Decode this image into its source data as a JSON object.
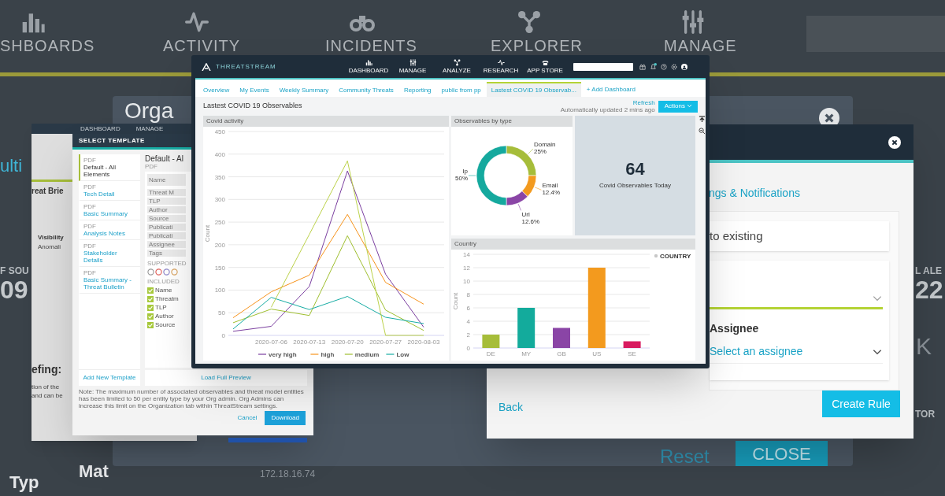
{
  "background_app": {
    "nav": [
      "SHBOARDS",
      "ACTIVITY",
      "INCIDENTS",
      "EXPLORER",
      "MANAGE"
    ],
    "panel_title": "Orga",
    "texts": [
      {
        "text": "ulti",
        "kind": "link"
      },
      {
        "text": "F SOU",
        "kind": "label"
      },
      {
        "text": "09",
        "kind": "big"
      },
      {
        "text": "Mat",
        "kind": "heading"
      },
      {
        "text": "Typ",
        "kind": "heading"
      },
      {
        "text": "172.18.16.74",
        "kind": "faint"
      },
      {
        "text": "L ALE",
        "kind": "label"
      },
      {
        "text": "22",
        "kind": "big"
      },
      {
        "text": "K",
        "kind": "faint-big"
      },
      {
        "text": "TOR",
        "kind": "label"
      }
    ],
    "footer_buttons": [
      {
        "label": "Reset",
        "kind": "link"
      },
      {
        "label": "CLOSE",
        "kind": "primary"
      }
    ]
  },
  "report_window": {
    "nav": [
      "DASHBOARD",
      "MANAGE"
    ],
    "texts": [
      "reat Brie",
      "Visibility",
      "Anomali",
      "efing:",
      "tion of the",
      "and can be"
    ]
  },
  "template_dialog": {
    "title": "SELECT TEMPLATE",
    "templates": [
      {
        "type": "PDF",
        "name": "Default - All Elements",
        "selected": true
      },
      {
        "type": "PDF",
        "name": "Tech Detail",
        "selected": false
      },
      {
        "type": "PDF",
        "name": "Basic Summary",
        "selected": false
      },
      {
        "type": "PDF",
        "name": "Analysis Notes",
        "selected": false
      },
      {
        "type": "PDF",
        "name": "Stakeholder Details",
        "selected": false
      },
      {
        "type": "PDF",
        "name": "Basic Summary - Threat Bulletin",
        "selected": false
      }
    ],
    "add_template": "Add New Template",
    "preview_title": "Default - Al",
    "preview_type": "PDF",
    "fields": [
      "Name",
      "Threat M",
      "TLP",
      "Author",
      "Source",
      "Publicati",
      "Publicati",
      "Assignee",
      "Tags"
    ],
    "media_label": "SUPPORTED",
    "elements_label": "INCLUDED",
    "elements": [
      {
        "label": "Name",
        "checked": true
      },
      {
        "label": "Threatm",
        "checked": true
      },
      {
        "label": "TLP",
        "checked": true
      },
      {
        "label": "Author",
        "checked": true
      },
      {
        "label": "Source",
        "checked": true
      }
    ],
    "load_preview": "Load Full Preview",
    "note": "Note: The maximum number of associated observables and threat model entities has been limited to 50 per entity type by your Org admin. Org Admins can increase this limit on the Organization tab within ThreatStream settings.",
    "buttons": [
      {
        "label": "Cancel",
        "kind": "link"
      },
      {
        "label": "Download",
        "kind": "primary"
      }
    ]
  },
  "rule_dialog": {
    "section_title": "ngs & Notifications",
    "option": "to existing",
    "assignee_label": "Assignee",
    "assignee_placeholder": "Select an assignee",
    "back": "Back",
    "create": "Create Rule"
  },
  "main_window": {
    "brand": "THREATSTREAM",
    "nav": [
      "DASHBOARD",
      "MANAGE",
      "ANALYZE",
      "RESEARCH",
      "APP STORE"
    ],
    "tabs": [
      {
        "label": "Overview",
        "selected": false
      },
      {
        "label": "My Events",
        "selected": false
      },
      {
        "label": "Weekly Summary",
        "selected": false
      },
      {
        "label": "Community Threats",
        "selected": false
      },
      {
        "label": "Reporting",
        "selected": false
      },
      {
        "label": "public from pp",
        "selected": false
      },
      {
        "label": "Lastest COVID 19 Observab...",
        "selected": true
      }
    ],
    "add_tab": "+ Add Dashboard",
    "title": "Lastest COVID 19 Observables",
    "refresh": "Refresh",
    "updated": "Automatically updated 2 mins ago",
    "actions": "Actions",
    "activity": {
      "title": "Covid activity",
      "chart_data": {
        "type": "line",
        "ylabel": "Count",
        "categories": [
          null,
          "2020-07-06",
          "2020-07-13",
          "2020-07-20",
          "2020-07-27",
          "2020-08-03"
        ],
        "ylim": [
          0,
          450
        ],
        "yticks": [
          0,
          50,
          100,
          150,
          200,
          250,
          300,
          350,
          400,
          450
        ],
        "grid": true,
        "legend": true,
        "series": [
          {
            "name": "very high",
            "color": "#7b3fa0",
            "values": [
              9,
              20,
              108,
              363,
              135,
              18
            ]
          },
          {
            "name": "high",
            "color": "#f7941d",
            "values": [
              39,
              96,
              133,
              267,
              117,
              69
            ]
          },
          {
            "name": "medium",
            "color": "#9fbf2f",
            "values": [
              28,
              58,
              44,
              220,
              56,
              11
            ]
          },
          {
            "name": "Low",
            "color": "#17aca4",
            "values": [
              14,
              84,
              57,
              86,
              40,
              26
            ]
          },
          {
            "color": "#bcd24a",
            "values": [
              null,
              62,
              223,
              385,
              0,
              0
            ]
          }
        ]
      }
    },
    "by_type": {
      "title": "Observables by type",
      "chart_data": {
        "type": "donut",
        "categories": [
          "Domain",
          "Email",
          "Url",
          "Ip"
        ],
        "series": [
          {
            "values": [
              25,
              12.4,
              12.6,
              50
            ],
            "colors": [
              "#a6bd3a",
              "#f39a1e",
              "#8a45a6",
              "#15a99e"
            ]
          }
        ],
        "value_labels": [
          "25%",
          "12.4%",
          "12.6%",
          "50%"
        ]
      }
    },
    "stat": {
      "value": "64",
      "label": "Covid Observables Today"
    },
    "country": {
      "title": "Country",
      "chart_data": {
        "type": "bar",
        "ylabel": "Count",
        "categories": [
          "DE",
          "MY",
          "GB",
          "US",
          "SE"
        ],
        "ylim": [
          0,
          14
        ],
        "yticks": [
          0,
          2,
          4,
          6,
          8,
          10,
          12,
          14
        ],
        "grid": true,
        "legend": true,
        "series": [
          {
            "name": "COUNTRY",
            "values": [
              2,
              6,
              3,
              12,
              1
            ],
            "colors": [
              "#a6bd3a",
              "#13ab9c",
              "#8a45a6",
              "#f39a1e",
              "#d81b60"
            ]
          }
        ]
      }
    }
  }
}
